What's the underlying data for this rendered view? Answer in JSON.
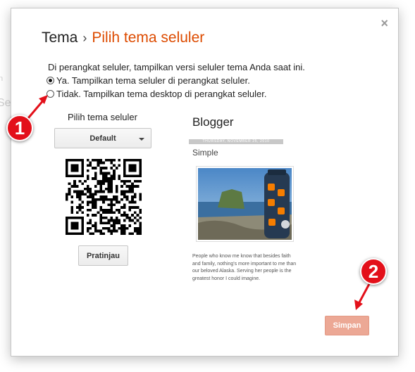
{
  "background": {
    "fragment_small": "n",
    "fragment_large": "Se"
  },
  "dialog": {
    "title_main": "Tema",
    "title_sep": "›",
    "title_sub": "Pilih tema seluler",
    "close_label": "×",
    "description": "Di perangkat seluler, tampilkan versi seluler tema Anda saat ini.",
    "options": [
      {
        "label": "Ya. Tampilkan tema seluler di perangkat seluler.",
        "checked": true
      },
      {
        "label": "Tidak. Tampilkan tema desktop di perangkat seluler.",
        "checked": false
      }
    ],
    "left": {
      "label": "Pilih tema seluler",
      "dropdown_value": "Default",
      "preview_button": "Pratinjau"
    },
    "preview": {
      "blog_title": "Blogger",
      "date": "THURSDAY, NOVEMBER 25, 2010",
      "post_title": "Simple",
      "post_text": "People who know me know that besides faith and family, nothing's more important to me than our beloved Alaska. Serving her people is the greatest honor I could imagine."
    },
    "save_button": "Simpan"
  },
  "annotations": {
    "callout_1": "1",
    "callout_2": "2"
  },
  "colors": {
    "accent_orange": "#dd4b00",
    "save_button": "#eca895",
    "callout_red": "#e3101a"
  },
  "icons": {
    "close": "close-icon",
    "dropdown": "chevron-down-icon",
    "qr": "qr-code-icon"
  }
}
